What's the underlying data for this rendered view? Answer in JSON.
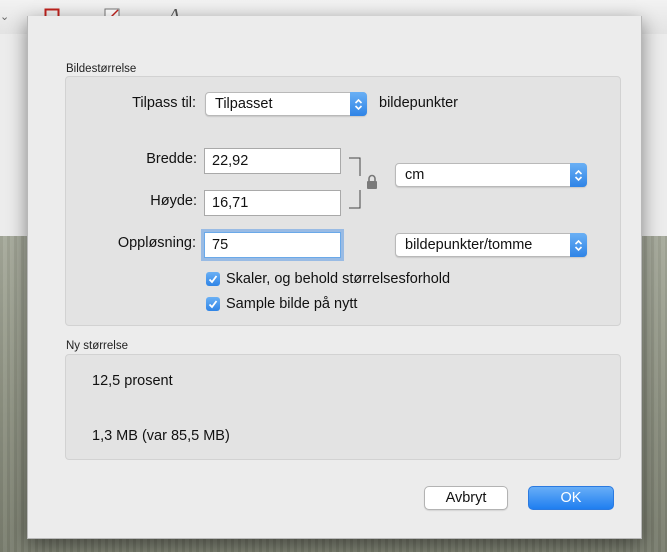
{
  "toolbar": {
    "items": [
      {
        "icon": "partial-chevron-icon"
      },
      {
        "icon": "border-color-icon"
      },
      {
        "icon": "fill-color-icon"
      },
      {
        "icon": "text-style-icon",
        "glyph": "A"
      }
    ]
  },
  "dialog": {
    "image_size_section": "Bildestørrelse",
    "fit_label": "Tilpass til:",
    "fit_value": "Tilpasset",
    "fit_unit_label": "bildepunkter",
    "width_label": "Bredde:",
    "width_value": "22,92",
    "height_label": "Høyde:",
    "height_value": "16,71",
    "size_unit_value": "cm",
    "resolution_label": "Oppløsning:",
    "resolution_value": "75",
    "resolution_unit_value": "bildepunkter/tomme",
    "scale_checkbox_label": "Skaler, og behold størrelsesforhold",
    "scale_checked": true,
    "resample_checkbox_label": "Sample bilde på nytt",
    "resample_checked": true,
    "new_size_section": "Ny størrelse",
    "new_size_percent": "12,5 prosent",
    "new_size_bytes": "1,3 MB (var 85,5 MB)",
    "cancel_label": "Avbryt",
    "ok_label": "OK"
  },
  "colors": {
    "accent": "#2f84e6",
    "dialog_bg": "#ececec"
  }
}
